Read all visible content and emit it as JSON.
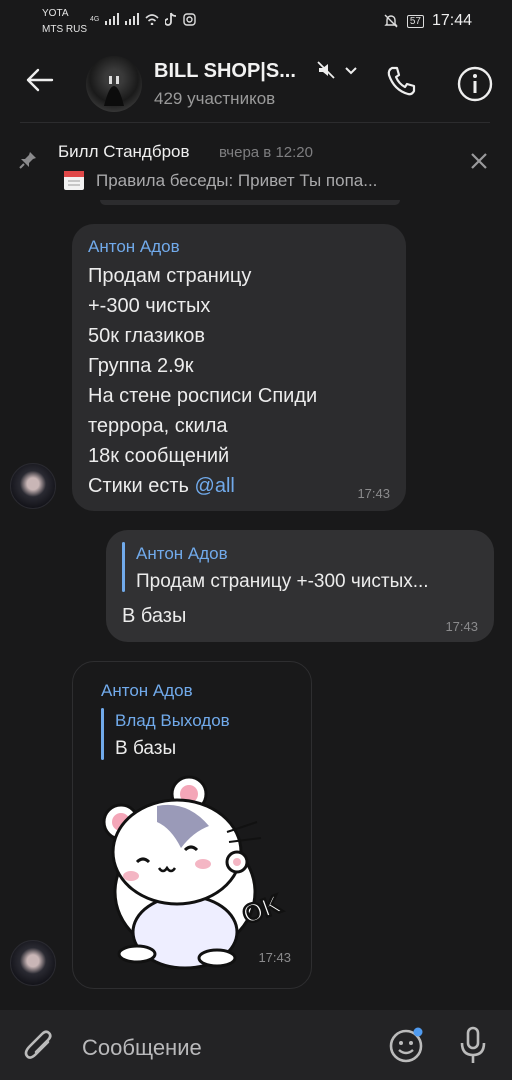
{
  "status": {
    "carrier1": "YOTA",
    "carrier2": "MTS RUS",
    "network": "4G",
    "battery": "57",
    "time": "17:44"
  },
  "header": {
    "title": "BILL SHOP|S...",
    "subtitle": "429 участников"
  },
  "pinned": {
    "author": "Билл Стандбров",
    "time": "вчера в 12:20",
    "text": "Правила беседы: Привет  Ты попа..."
  },
  "messages": [
    {
      "sender": "Антон Адов",
      "lines": [
        "Продам страницу",
        "+-300 чистых",
        "50к глазиков",
        "Группа 2.9к",
        "На стене росписи Спиди",
        "террора, скила",
        "18к сообщений"
      ],
      "last_line": "Стики есть ",
      "mention": "@all",
      "time": "17:43"
    },
    {
      "reply_name": "Антон Адов",
      "reply_text": "Продам страницу  +-300 чистых...",
      "text": "В базы",
      "time": "17:43"
    },
    {
      "sender": "Антон Адов",
      "reply_name": "Влад Выходов",
      "reply_text": "В базы",
      "sticker_text": "OK",
      "time": "17:43"
    }
  ],
  "input": {
    "placeholder": "Сообщение"
  }
}
